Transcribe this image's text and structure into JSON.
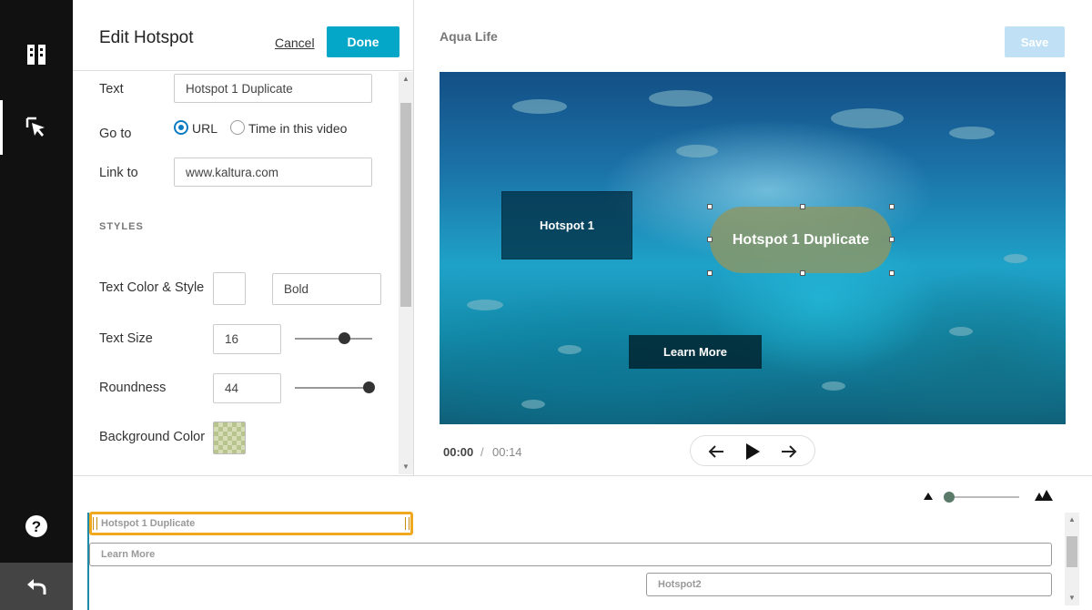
{
  "rail": {
    "items": [
      "layout-icon",
      "cursor-icon",
      "help-icon"
    ],
    "undo_icon": "undo-icon"
  },
  "panel": {
    "title": "Edit Hotspot",
    "cancel_label": "Cancel",
    "done_label": "Done",
    "text_label": "Text",
    "text_value": "Hotspot 1 Duplicate",
    "goto_label": "Go to",
    "goto_options": [
      "URL",
      "Time in this video"
    ],
    "goto_selected": "URL",
    "link_label": "Link to",
    "link_value": "www.kaltura.com",
    "styles_heading": "STYLES",
    "text_color_label": "Text Color & Style",
    "text_color": "#ffffff",
    "text_style": "Bold",
    "text_size_label": "Text Size",
    "text_size": "16",
    "roundness_label": "Roundness",
    "roundness": "44",
    "background_label": "Background Color"
  },
  "player": {
    "title": "Aqua Life",
    "save_label": "Save",
    "hotspots": [
      "Hotspot 1",
      "Hotspot 1 Duplicate",
      "Learn More"
    ],
    "current_time": "00:00",
    "separator": "/",
    "duration": "00:14"
  },
  "timeline": {
    "tracks": [
      "Hotspot 1 Duplicate",
      "Learn More",
      "Hotspot2"
    ],
    "selected": "Hotspot 1 Duplicate"
  },
  "colors": {
    "accent": "#05a7c9",
    "selection": "#f0a81e",
    "save_disabled": "#bfe0f5",
    "rail": "#111111"
  }
}
